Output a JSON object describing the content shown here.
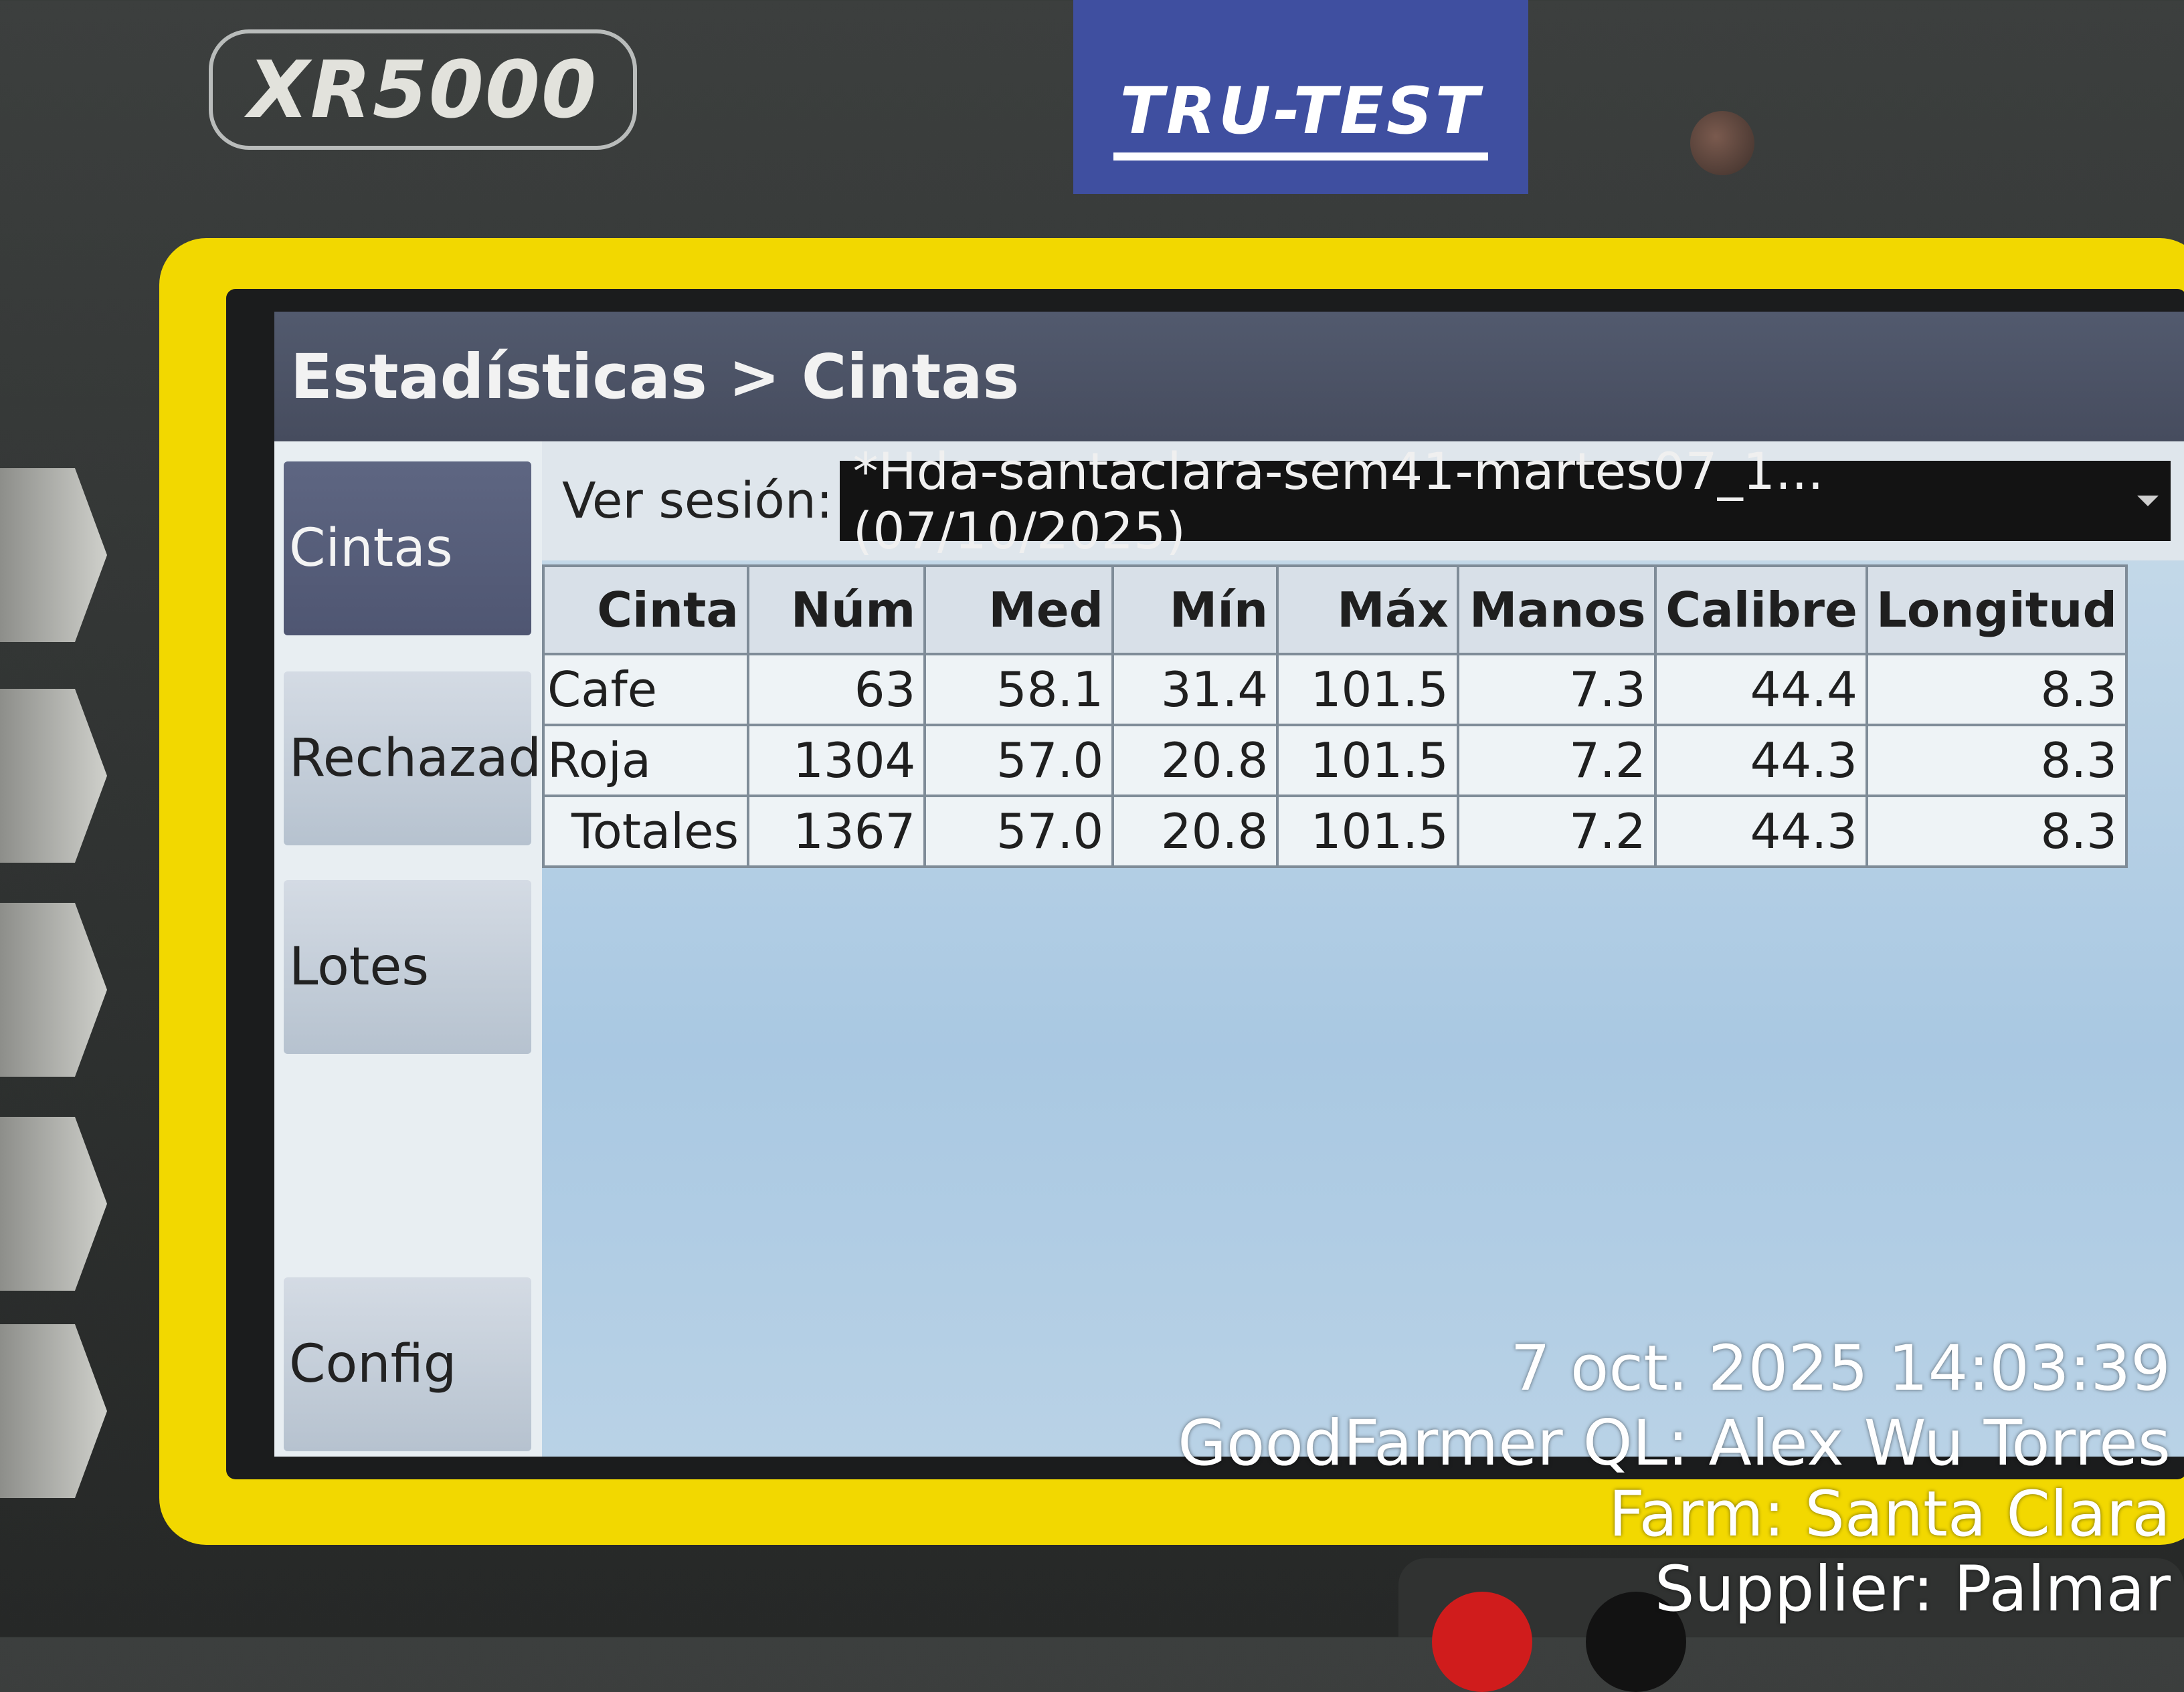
{
  "device": {
    "model": "XR5000",
    "brand": "TRU-TEST"
  },
  "screen": {
    "title": "Estadísticas > Cintas",
    "sidebar": [
      {
        "label": "Cintas",
        "active": true
      },
      {
        "label": "Rechazad",
        "active": false
      },
      {
        "label": "Lotes",
        "active": false
      },
      {
        "label": "Config",
        "active": false
      }
    ],
    "session": {
      "label": "Ver sesión:",
      "value": "*Hda-santaclara-sem41-martes07_1... (07/10/2025)"
    },
    "table": {
      "headers": [
        "Cinta",
        "Núm",
        "Med",
        "Mín",
        "Máx",
        "Manos",
        "Calibre",
        "Longitud"
      ],
      "rows": [
        [
          "Cafe",
          "63",
          "58.1",
          "31.4",
          "101.5",
          "7.3",
          "44.4",
          "8.3"
        ],
        [
          "Roja",
          "1304",
          "57.0",
          "20.8",
          "101.5",
          "7.2",
          "44.3",
          "8.3"
        ],
        [
          "Totales",
          "1367",
          "57.0",
          "20.8",
          "101.5",
          "7.2",
          "44.3",
          "8.3"
        ]
      ]
    }
  },
  "overlay": {
    "timestamp": "7 oct. 2025 14:03:39",
    "line1": "GoodFarmer QL: Alex Wu Torres",
    "line2": "Farm: Santa Clara",
    "line3": "Supplier: Palmar"
  }
}
